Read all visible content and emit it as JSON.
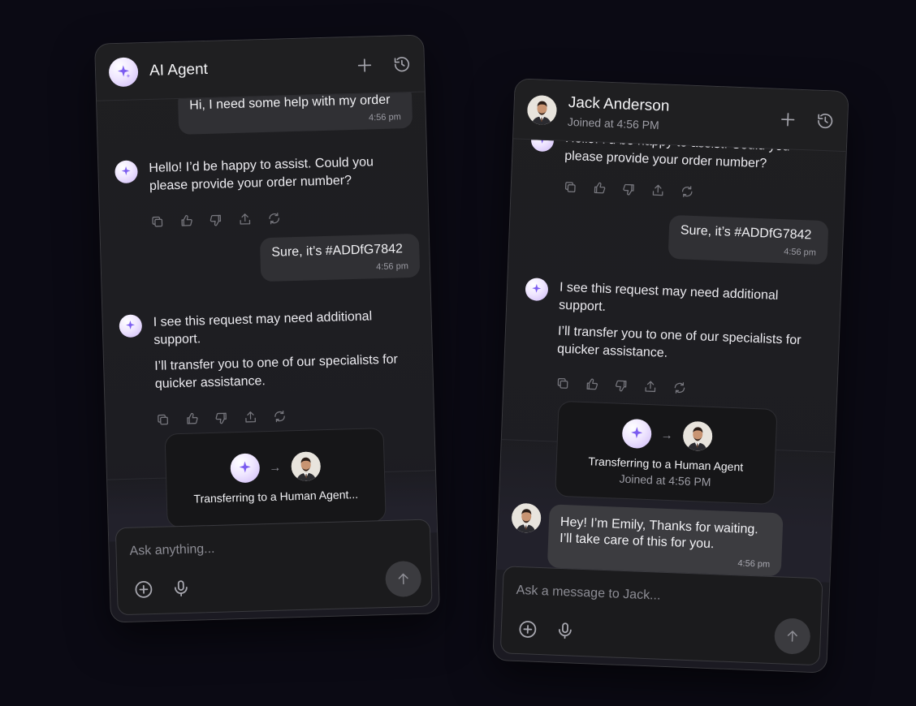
{
  "left_panel": {
    "title": "AI Agent",
    "messages": [
      {
        "role": "user",
        "text": "Hi, I need some help with my order",
        "time": "4:56 pm"
      },
      {
        "role": "ai",
        "paragraphs": [
          "Hello! I’d be happy to assist. Could you please provide your order number?"
        ]
      },
      {
        "role": "user",
        "text": "Sure, it’s #ADDfG7842",
        "time": "4:56 pm"
      },
      {
        "role": "ai",
        "paragraphs": [
          "I see this request may need additional support.",
          "I’ll transfer you to one of our specialists for quicker assistance."
        ]
      }
    ],
    "transfer": {
      "title": "Transferring to a Human Agent..."
    },
    "composer": {
      "placeholder": "Ask anything..."
    }
  },
  "right_panel": {
    "title": "Jack Anderson",
    "subtitle": "Joined at 4:56 PM",
    "messages": [
      {
        "role": "ai",
        "paragraphs": [
          "Hello! I’d be happy to assist. Could you please provide your order number?"
        ]
      },
      {
        "role": "user",
        "text": "Sure, it’s #ADDfG7842",
        "time": "4:56 pm"
      },
      {
        "role": "ai",
        "paragraphs": [
          "I see this request may need additional support.",
          "I’ll transfer you to one of our specialists for quicker assistance."
        ]
      },
      {
        "role": "human",
        "text": "Hey! I’m Emily, Thanks for waiting. I’ll take care of this for you.",
        "time": "4:56 pm"
      }
    ],
    "transfer": {
      "title": "Transferring to a Human Agent",
      "subtitle": "Joined at 4:56 PM"
    },
    "composer": {
      "placeholder": "Ask a message to Jack..."
    }
  },
  "icons": {
    "header": [
      "plus-icon",
      "history-icon"
    ],
    "message_actions": [
      "copy-icon",
      "thumbs-up-icon",
      "thumbs-down-icon",
      "share-icon",
      "regenerate-icon"
    ],
    "composer": [
      "add-circle-icon",
      "microphone-icon",
      "send-arrow-up-icon"
    ]
  },
  "colors": {
    "background": "#0b0a14",
    "panel": "#1f1f21",
    "accent_avatar": "#cdb8f7"
  }
}
